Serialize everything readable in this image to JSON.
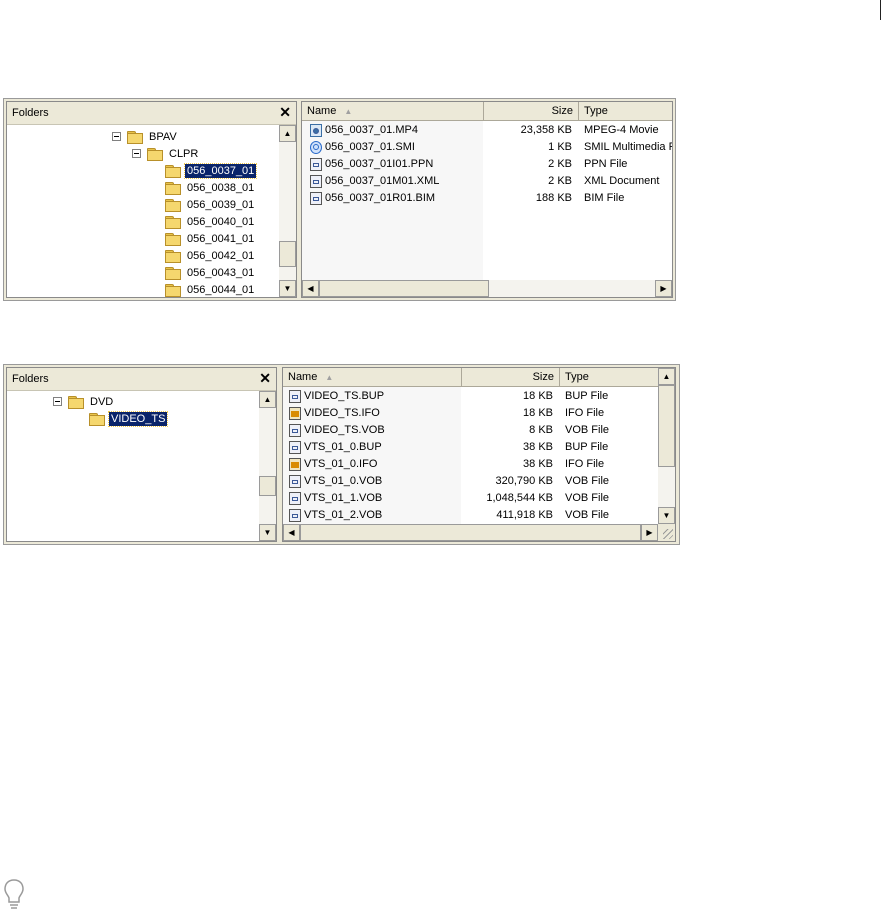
{
  "window1": {
    "folders_title": "Folders",
    "close_glyph": "✕",
    "tree": [
      {
        "label": "BPAV",
        "expanded": true
      },
      {
        "label": "CLPR",
        "expanded": true
      },
      {
        "label": "056_0037_01",
        "selected": true
      },
      {
        "label": "056_0038_01"
      },
      {
        "label": "056_0039_01"
      },
      {
        "label": "056_0040_01"
      },
      {
        "label": "056_0041_01"
      },
      {
        "label": "056_0042_01"
      },
      {
        "label": "056_0043_01"
      },
      {
        "label": "056_0044_01"
      }
    ],
    "columns": {
      "name": "Name",
      "size": "Size",
      "type": "Type"
    },
    "files": [
      {
        "name": "056_0037_01.MP4",
        "size": "23,358 KB",
        "type": "MPEG-4 Movie",
        "icon": "mp4-icon"
      },
      {
        "name": "056_0037_01.SMI",
        "size": "1 KB",
        "type": "SMIL Multimedia P",
        "icon": "smil-icon"
      },
      {
        "name": "056_0037_01I01.PPN",
        "size": "2 KB",
        "type": "PPN File",
        "icon": "file-icon"
      },
      {
        "name": "056_0037_01M01.XML",
        "size": "2 KB",
        "type": "XML Document",
        "icon": "file-icon"
      },
      {
        "name": "056_0037_01R01.BIM",
        "size": "188 KB",
        "type": "BIM File",
        "icon": "file-icon"
      }
    ]
  },
  "window2": {
    "folders_title": "Folders",
    "close_glyph": "✕",
    "tree": [
      {
        "label": "DVD",
        "expanded": true
      },
      {
        "label": "VIDEO_TS",
        "selected": true
      }
    ],
    "columns": {
      "name": "Name",
      "size": "Size",
      "type": "Type"
    },
    "files": [
      {
        "name": "VIDEO_TS.BUP",
        "size": "18 KB",
        "type": "BUP File",
        "icon": "file-icon"
      },
      {
        "name": "VIDEO_TS.IFO",
        "size": "18 KB",
        "type": "IFO File",
        "icon": "ifo-icon"
      },
      {
        "name": "VIDEO_TS.VOB",
        "size": "8 KB",
        "type": "VOB File",
        "icon": "file-icon"
      },
      {
        "name": "VTS_01_0.BUP",
        "size": "38 KB",
        "type": "BUP File",
        "icon": "file-icon"
      },
      {
        "name": "VTS_01_0.IFO",
        "size": "38 KB",
        "type": "IFO File",
        "icon": "ifo-icon"
      },
      {
        "name": "VTS_01_0.VOB",
        "size": "320,790 KB",
        "type": "VOB File",
        "icon": "file-icon"
      },
      {
        "name": "VTS_01_1.VOB",
        "size": "1,048,544 KB",
        "type": "VOB File",
        "icon": "file-icon"
      },
      {
        "name": "VTS_01_2.VOB",
        "size": "411,918 KB",
        "type": "VOB File",
        "icon": "file-icon"
      }
    ]
  },
  "colors": {
    "selection": "#0a246a",
    "chrome": "#ece9d8",
    "folder": "#f5d76e"
  }
}
